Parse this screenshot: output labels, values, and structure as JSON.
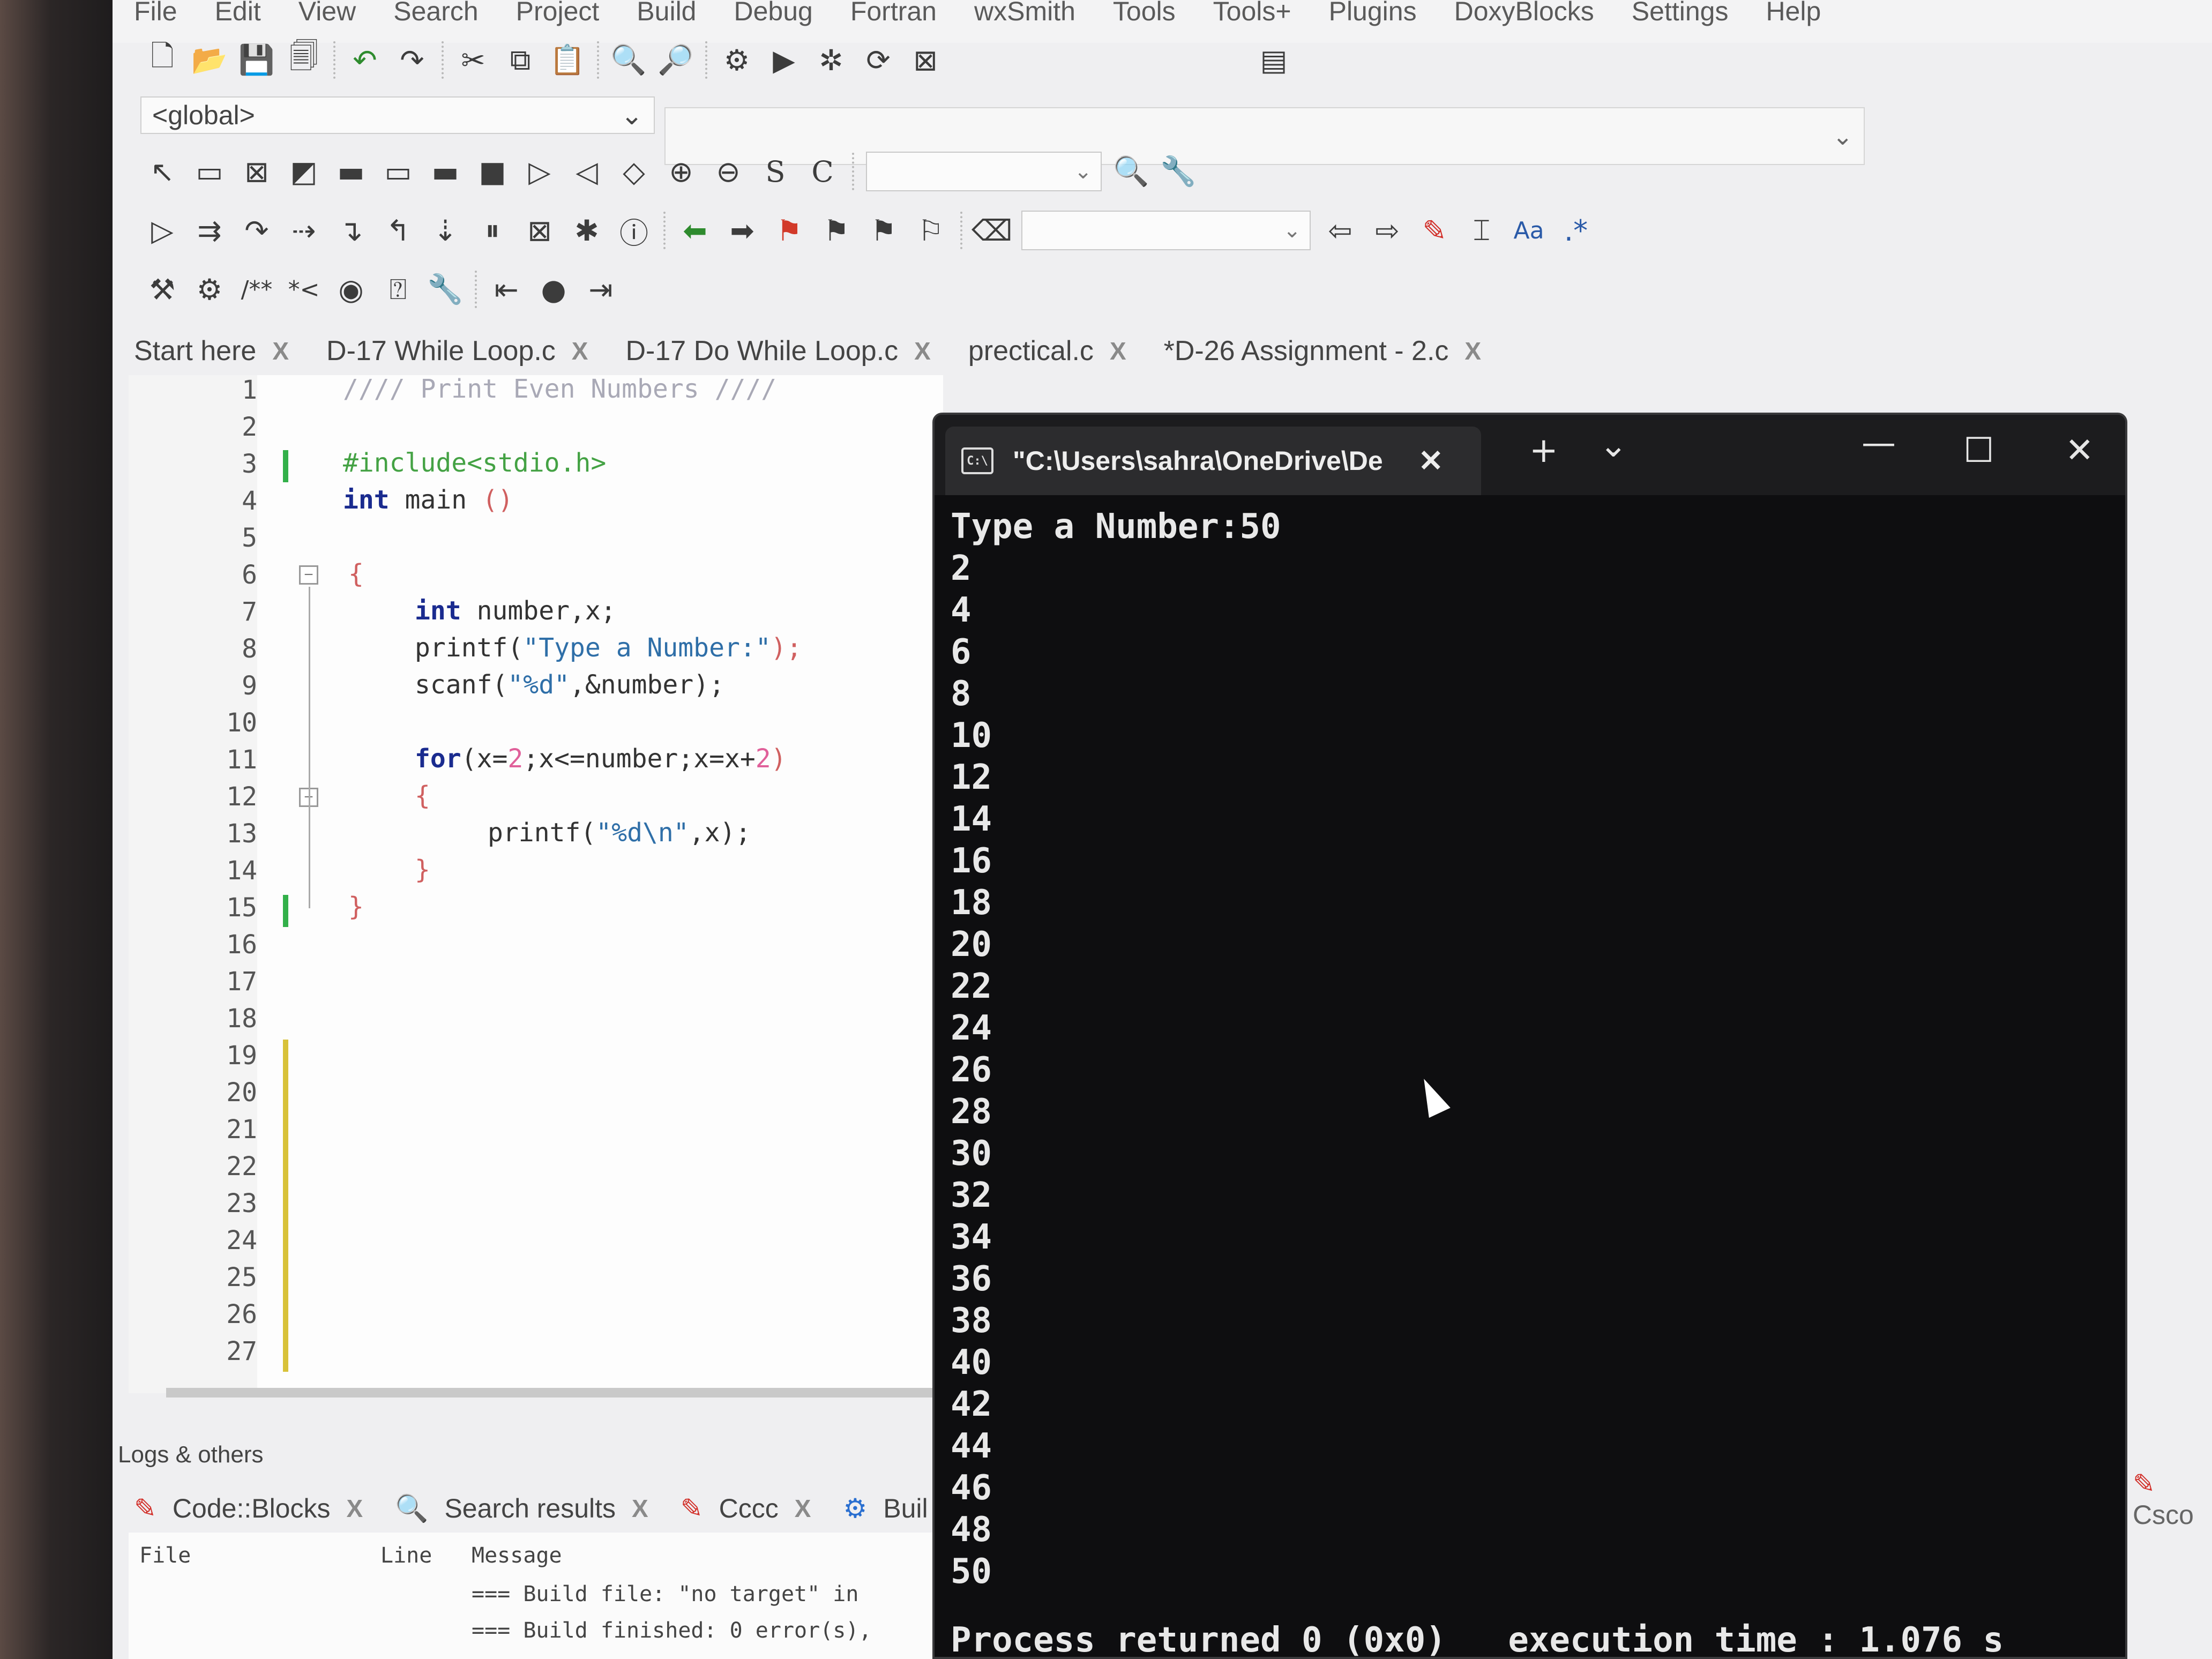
{
  "menu": [
    "File",
    "Edit",
    "View",
    "Search",
    "Project",
    "Build",
    "Debug",
    "Fortran",
    "wxSmith",
    "Tools",
    "Tools+",
    "Plugins",
    "DoxyBlocks",
    "Settings",
    "Help"
  ],
  "global_combo": "<global>",
  "editor_tabs": [
    {
      "label": "Start here"
    },
    {
      "label": "D-17  While Loop.c"
    },
    {
      "label": "D-17  Do While Loop.c"
    },
    {
      "label": "prectical.c"
    },
    {
      "label": "*D-26  Assignment - 2.c"
    }
  ],
  "line_numbers": [
    "1",
    "2",
    "3",
    "4",
    "5",
    "6",
    "7",
    "8",
    "9",
    "10",
    "11",
    "12",
    "13",
    "14",
    "15",
    "16",
    "17",
    "18",
    "19",
    "20",
    "21",
    "22",
    "23",
    "24",
    "25",
    "26",
    "27"
  ],
  "code": {
    "l1": "//// Print Even Numbers ////",
    "l3": "#include<stdio.h>",
    "l4_kw": "int",
    "l4_rest": " main ",
    "l4_paren": "()",
    "l6": "{",
    "l7_kw": "int",
    "l7_rest": " number,x;",
    "l8_fn": "printf(",
    "l8_str": "\"Type a Number:\"",
    "l8_end": ");",
    "l9_fn": "scanf(",
    "l9_str": "\"%d\"",
    "l9_end": ",&number);",
    "l11_kw": "for",
    "l11_a": "(x=",
    "l11_n1": "2",
    "l11_b": ";x<=number;x=x+",
    "l11_n2": "2",
    "l11_c": ")",
    "l12": "{",
    "l13_fn": "printf(",
    "l13_str": "\"%d\\n\"",
    "l13_end": ",x);",
    "l14": "}",
    "l15": "}"
  },
  "logs": {
    "title": "Logs & others",
    "tabs": [
      "Code::Blocks",
      "Search results",
      "Cccc",
      "Buil"
    ],
    "headers": {
      "file": "File",
      "line": "Line",
      "message": "Message"
    },
    "rows": [
      "=== Build file: \"no target\" in",
      "=== Build finished: 0 error(s),"
    ]
  },
  "terminal": {
    "title": "\"C:\\Users\\sahra\\OneDrive\\De",
    "icon": "C:\\",
    "new_tab": "+",
    "dropdown": "⌄",
    "minimize": "—",
    "maximize": "☐",
    "close": "✕",
    "prompt_line": "Type a Number:50",
    "output": [
      "2",
      "4",
      "6",
      "8",
      "10",
      "12",
      "14",
      "16",
      "18",
      "20",
      "22",
      "24",
      "26",
      "28",
      "30",
      "32",
      "34",
      "36",
      "38",
      "40",
      "42",
      "44",
      "46",
      "48",
      "50"
    ],
    "footer": "Process returned 0 (0x0)   execution time : 1.076 s"
  },
  "right_tab": "Csco"
}
